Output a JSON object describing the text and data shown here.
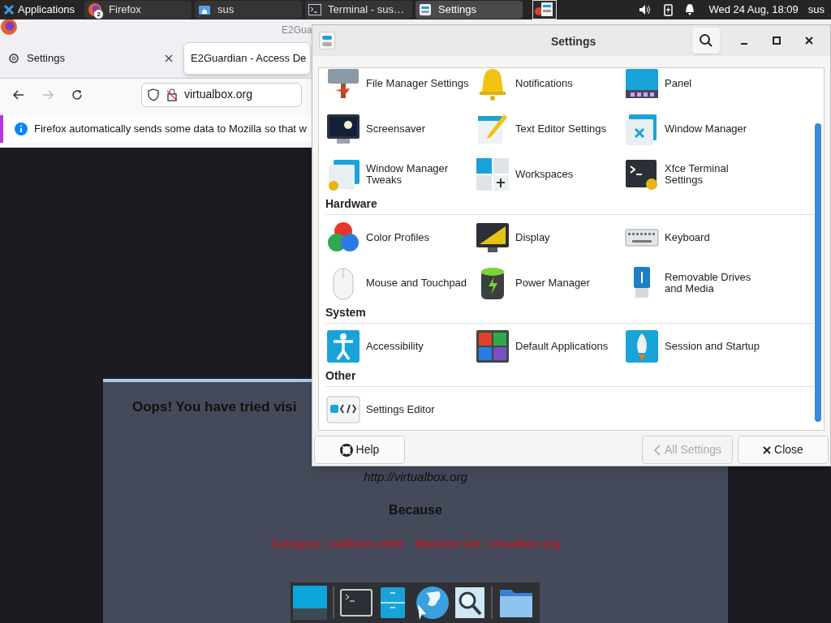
{
  "panel": {
    "apps_menu": "Applications",
    "tasks": [
      {
        "label": "Firefox",
        "selected": false,
        "badge": "2"
      },
      {
        "label": "sus",
        "selected": false
      },
      {
        "label": "Terminal - sus…",
        "selected": false
      },
      {
        "label": "Settings",
        "selected": true
      }
    ],
    "clock": "Wed 24 Aug, 18:09",
    "user": "sus"
  },
  "browser": {
    "window_title": "E2Gua",
    "tabs": [
      {
        "label": "Settings",
        "selected": false
      },
      {
        "label": "E2Guardian - Access De",
        "selected": true
      }
    ],
    "url": "virtualbox.org",
    "notice": "Firefox automatically sends some data to Mozilla so that w",
    "page": {
      "heading": "Oops! You have tried visi",
      "url": "http://virtualbox.org",
      "because": "Because",
      "reason": "Category: colabnet-other   Blocked site: virtualbox.org"
    }
  },
  "settings": {
    "title": "Settings",
    "sections": [
      {
        "items": [
          "File Manager Settings",
          "Notifications",
          "Panel",
          "Screensaver",
          "Text Editor Settings",
          "Window Manager",
          "Window Manager Tweaks",
          "Workspaces",
          "Xfce Terminal Settings"
        ]
      },
      {
        "heading": "Hardware",
        "items": [
          "Color Profiles",
          "Display",
          "Keyboard",
          "Mouse and Touchpad",
          "Power Manager",
          "Removable Drives and Media"
        ]
      },
      {
        "heading": "System",
        "items": [
          "Accessibility",
          "Default Applications",
          "Session and Startup"
        ]
      },
      {
        "heading": "Other",
        "items": [
          "Settings Editor"
        ]
      }
    ],
    "buttons": [
      {
        "label": "Help",
        "disabled": false
      },
      {
        "label": "All Settings",
        "disabled": true
      },
      {
        "label": "Close",
        "disabled": false
      }
    ]
  }
}
